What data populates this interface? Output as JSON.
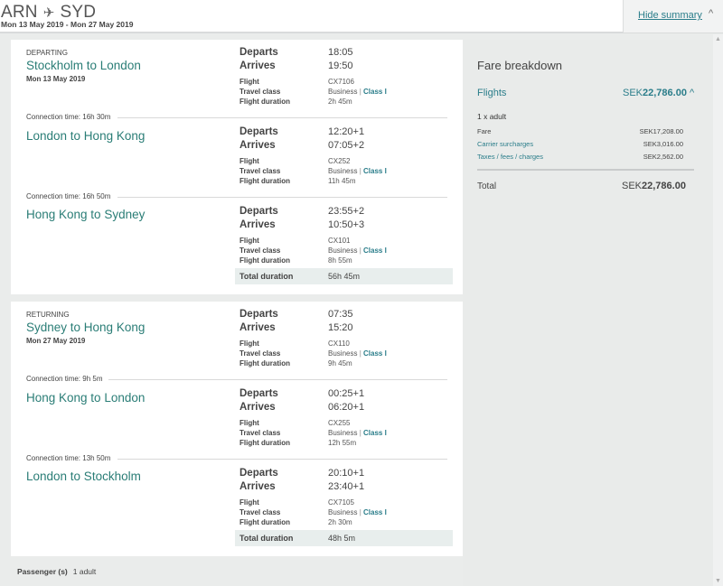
{
  "header": {
    "origin": "ARN",
    "destination": "SYD",
    "plane_icon": "✈",
    "dates": "Mon 13 May 2019 - Mon 27 May 2019",
    "hide_summary": "Hide summary",
    "chevron_up": "^"
  },
  "labels": {
    "departs": "Departs",
    "arrives": "Arrives",
    "flight": "Flight",
    "travel_class": "Travel class",
    "flight_duration": "Flight duration",
    "total_duration": "Total duration",
    "class_sep": " | "
  },
  "outbound": {
    "direction": "DEPARTING",
    "date": "Mon 13 May 2019",
    "total_duration": "56h 45m",
    "segments": [
      {
        "title": "Stockholm to London",
        "departs": "18:05",
        "arrives": "19:50",
        "flight": "CX7106",
        "cabin": "Business",
        "booking_class": "Class I",
        "duration": "2h 45m"
      },
      {
        "connection": "Connection time: 16h 30m",
        "title": "London to Hong Kong",
        "departs": "12:20+1",
        "arrives": "07:05+2",
        "flight": "CX252",
        "cabin": "Business",
        "booking_class": "Class I",
        "duration": "11h 45m"
      },
      {
        "connection": "Connection time: 16h 50m",
        "title": "Hong Kong to Sydney",
        "departs": "23:55+2",
        "arrives": "10:50+3",
        "flight": "CX101",
        "cabin": "Business",
        "booking_class": "Class I",
        "duration": "8h 55m"
      }
    ]
  },
  "inbound": {
    "direction": "RETURNING",
    "date": "Mon 27 May 2019",
    "total_duration": "48h 5m",
    "segments": [
      {
        "title": "Sydney to Hong Kong",
        "departs": "07:35",
        "arrives": "15:20",
        "flight": "CX110",
        "cabin": "Business",
        "booking_class": "Class I",
        "duration": "9h 45m"
      },
      {
        "connection": "Connection time: 9h 5m",
        "title": "Hong Kong to London",
        "departs": "00:25+1",
        "arrives": "06:20+1",
        "flight": "CX255",
        "cabin": "Business",
        "booking_class": "Class I",
        "duration": "12h 55m"
      },
      {
        "connection": "Connection time: 13h 50m",
        "title": "London to Stockholm",
        "departs": "20:10+1",
        "arrives": "23:40+1",
        "flight": "CX7105",
        "cabin": "Business",
        "booking_class": "Class I",
        "duration": "2h 30m"
      }
    ]
  },
  "passenger": {
    "label": "Passenger (s)",
    "value": "1 adult"
  },
  "fare": {
    "title": "Fare breakdown",
    "flights_label": "Flights",
    "currency": "SEK",
    "flights_amount": "22,786.00",
    "chevron_up": "^",
    "adult_line": "1 x adult",
    "rows": [
      {
        "label": "Fare",
        "value": "SEK17,208.00"
      },
      {
        "label": "Carrier surcharges",
        "value": "SEK3,016.00"
      },
      {
        "label": "Taxes / fees / charges",
        "value": "SEK2,562.00"
      }
    ],
    "total_label": "Total",
    "total_amount": "22,786.00"
  },
  "scrollbar": {
    "up": "▲",
    "down": "▼"
  },
  "colors": {
    "accent": "#2a7d76",
    "link": "#2a7d8a",
    "background": "#eaeceb"
  }
}
